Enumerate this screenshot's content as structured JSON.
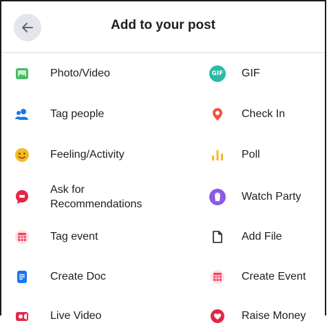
{
  "header": {
    "title": "Add to your post",
    "back_icon": "arrow-left-icon"
  },
  "left_items": [
    {
      "label": "Photo/Video",
      "icon": "photo-icon",
      "color": "#45bd62"
    },
    {
      "label": "Tag people",
      "icon": "people-icon",
      "color": "#1877f2"
    },
    {
      "label": "Feeling/Activity",
      "icon": "smiley-icon",
      "color": "#f7b928"
    },
    {
      "label": "Ask for Recommendations",
      "line1": "Ask for",
      "line2": "Recommendations",
      "icon": "speech-bubble-icon",
      "color": "#e42645"
    },
    {
      "label": "Tag event",
      "icon": "calendar-icon",
      "color": "#f3425f"
    },
    {
      "label": "Create Doc",
      "icon": "document-icon",
      "color": "#1877f2"
    },
    {
      "label": "Live Video",
      "icon": "video-camera-icon",
      "color": "#e42645"
    }
  ],
  "right_items": [
    {
      "label": "GIF",
      "icon": "gif-icon",
      "color": "#2abba7"
    },
    {
      "label": "Check In",
      "icon": "location-pin-icon",
      "color": "#f5533d"
    },
    {
      "label": "Poll",
      "icon": "bar-chart-icon",
      "color": "#f7b928"
    },
    {
      "label": "Watch Party",
      "icon": "watch-party-icon",
      "color": "#8c5ae6"
    },
    {
      "label": "Add File",
      "icon": "file-icon",
      "color": "#1c1e21"
    },
    {
      "label": "Create Event",
      "icon": "calendar-icon",
      "color": "#f3425f"
    },
    {
      "label": "Raise Money",
      "icon": "heart-icon",
      "color": "#e42645"
    }
  ]
}
